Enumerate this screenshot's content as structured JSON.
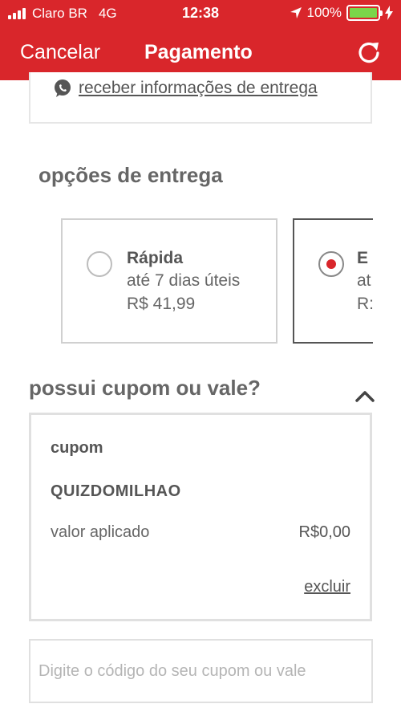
{
  "status_bar": {
    "carrier": "Claro BR",
    "network": "4G",
    "time": "12:38",
    "battery": "100%",
    "battery_level": 1.0
  },
  "nav": {
    "cancel_label": "Cancelar",
    "title": "Pagamento",
    "refresh_icon": "refresh-icon"
  },
  "delivery_info": {
    "link_label": "receber informações de entrega",
    "icon": "whatsapp-icon"
  },
  "delivery_options": {
    "title": "opções de entrega",
    "options": [
      {
        "name": "Rápida",
        "days": "até 7 dias úteis",
        "price": "R$ 41,99",
        "selected": false
      },
      {
        "name": "E",
        "days": "at",
        "price": "R:",
        "selected": true
      }
    ]
  },
  "coupon": {
    "title": "possui cupom ou vale?",
    "label": "cupom",
    "code": "QUIZDOMILHAO",
    "applied_label": "valor aplicado",
    "applied_value": "R$0,00",
    "delete_label": "excluir",
    "input_placeholder": "Digite o código do seu cupom ou vale",
    "input_value": ""
  },
  "colors": {
    "brand_red": "#d9262b",
    "battery_green": "#7bd64a"
  }
}
